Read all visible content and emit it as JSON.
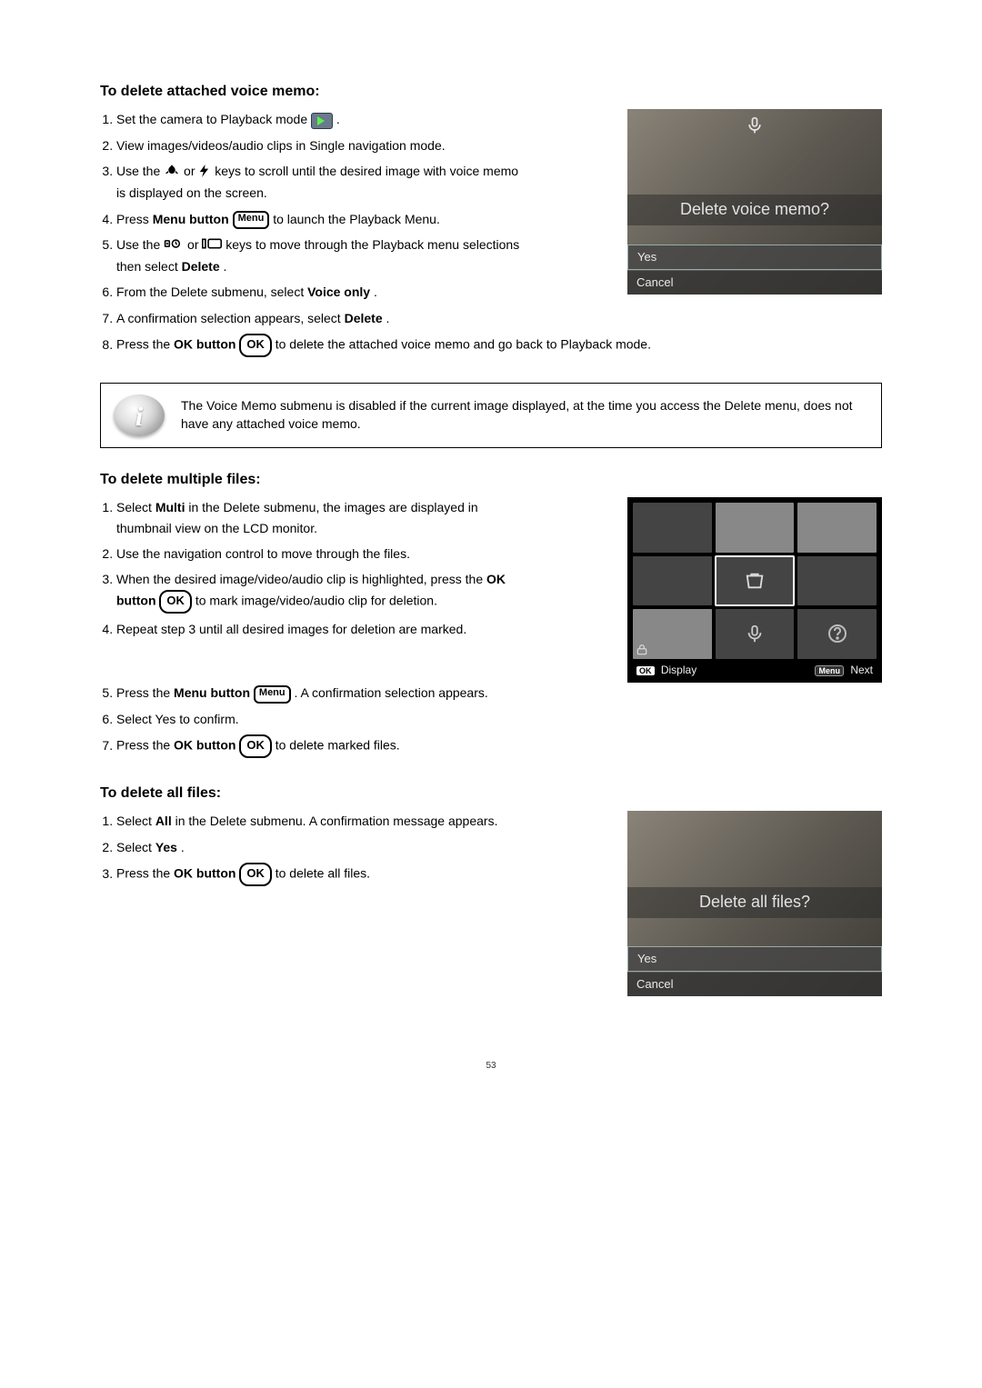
{
  "section1": {
    "heading": "To delete attached voice memo:",
    "steps": {
      "s1a": "Set the camera to Playback mode ",
      "s1b": ".",
      "s2": "View images/videos/audio clips in Single navigation mode.",
      "s3a": "Use the ",
      "s3b": " or ",
      "s3c": " keys to scroll until the desired image with voice memo is displayed on the screen.",
      "s4a": "Press ",
      "s4b": "Menu button",
      "s4c": " to launch the Playback Menu.",
      "s5a": "Use the ",
      "s5b": " or ",
      "s5c": " keys to move through the Playback menu selections then select ",
      "s5d": "Delete",
      "s5e": ".",
      "s6a": "From the Delete submenu, select ",
      "s6b": "Voice only",
      "s6c": ".",
      "s7a": "A confirmation selection appears, select ",
      "s7b": "Delete",
      "s7c": ".",
      "s8a": "Press the ",
      "s8b": "OK button",
      "s8c": " to delete the attached voice memo and go back to Playback mode."
    },
    "screen": {
      "title": "Delete voice memo?",
      "opt1": "Yes",
      "opt2": "Cancel"
    }
  },
  "note": {
    "text": "The Voice Memo submenu is disabled if the current image displayed, at the time you access the Delete menu, does not have any attached voice memo."
  },
  "section2": {
    "heading": "To delete multiple files:",
    "steps": {
      "s1a": "Select ",
      "s1b": "Multi",
      "s1c": " in the Delete submenu, the images are displayed in thumbnail view on the LCD monitor.",
      "s2": "Use the navigation control to move through the files.",
      "s3a": "When the desired image/video/audio clip is highlighted, press the ",
      "s3b": "OK button",
      "s3c": " to mark image/video/audio clip for deletion.",
      "s4": "Repeat step 3 until all desired images for deletion are marked.",
      "s5a": "Press the ",
      "s5b": "Menu button",
      "s5c": ". A confirmation selection appears.",
      "s6": "Select Yes to confirm.",
      "s7a": "Press the ",
      "s7b": "OK button",
      "s7c": " to delete marked files."
    },
    "thumbbar": {
      "ok_tag": "OK",
      "ok_label": "Display",
      "menu_tag": "Menu",
      "menu_label": "Next"
    }
  },
  "section3": {
    "heading": "To delete all files:",
    "steps": {
      "s1a": "Select ",
      "s1b": "All",
      "s1c": " in the Delete submenu. A confirmation message appears.",
      "s2a": "Select ",
      "s2b": "Yes",
      "s2c": ".",
      "s3a": "Press the ",
      "s3b": "OK button",
      "s3c": " to delete all files."
    },
    "screen": {
      "title": "Delete all files?",
      "opt1": "Yes",
      "opt2": "Cancel"
    }
  },
  "icon_labels": {
    "menu": "Menu",
    "ok": "OK"
  },
  "page_number": "53"
}
